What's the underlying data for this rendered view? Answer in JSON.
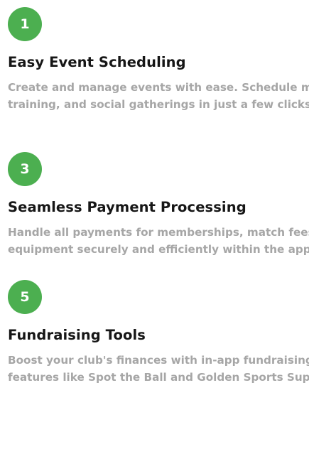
{
  "features": [
    {
      "number": "1",
      "title": "Easy Event Scheduling",
      "desc_line1": "Create and manage events with ease. Schedule matc",
      "desc_line2": "training, and social gatherings in just a few clicks."
    },
    {
      "number": "3",
      "title": "Seamless Payment Processing",
      "desc_line1": "Handle all payments for memberships, match fees, ar",
      "desc_line2": "equipment securely and efficiently within the app."
    },
    {
      "number": "5",
      "title": "Fundraising Tools",
      "desc_line1": "Boost your club's finances with in-app fundraising",
      "desc_line2": "features like Spot the Ball and Golden Sports Superd"
    }
  ],
  "colors": {
    "badge": "#4caf50",
    "title": "#161616",
    "description": "#a6a6a6"
  }
}
